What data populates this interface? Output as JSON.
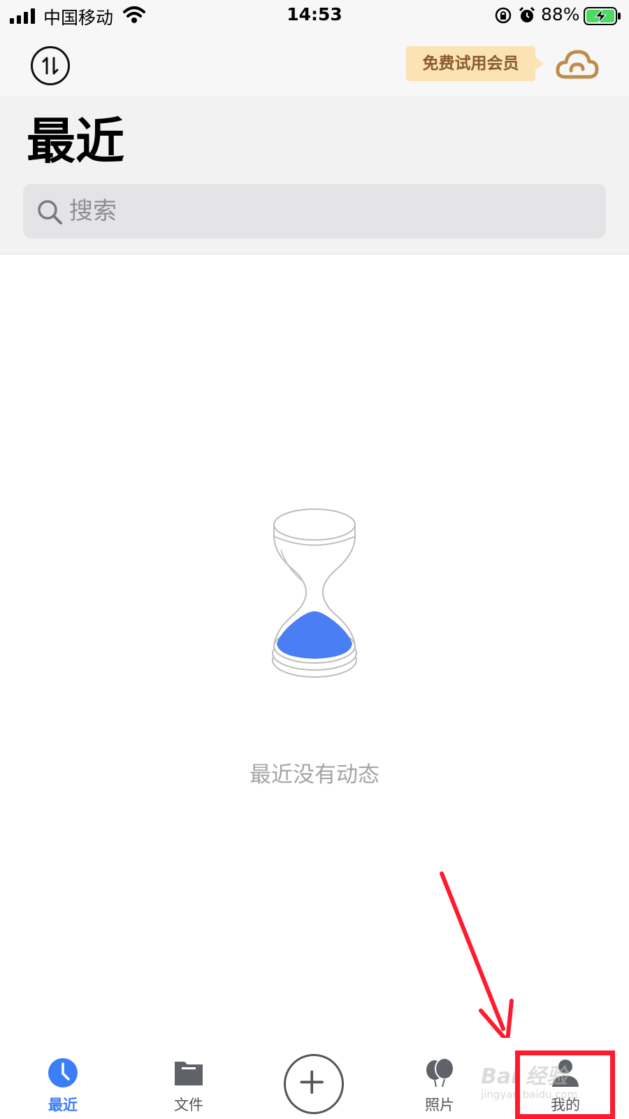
{
  "status_bar": {
    "carrier": "中国移动",
    "time": "14:53",
    "battery_percent": "88%"
  },
  "nav": {
    "member_badge": "免费试用会员"
  },
  "header": {
    "title": "最近",
    "search_placeholder": "搜索"
  },
  "empty_state": {
    "message": "最近没有动态"
  },
  "tabs": [
    {
      "label": "最近",
      "icon": "clock-icon",
      "active": true
    },
    {
      "label": "文件",
      "icon": "folder-icon",
      "active": false
    },
    {
      "label": "照片",
      "icon": "balloons-icon",
      "active": false
    },
    {
      "label": "我的",
      "icon": "person-icon",
      "active": false
    }
  ],
  "add_button": {
    "icon": "plus-icon"
  },
  "watermark": {
    "main": "Bai 经验",
    "sub": "jingyan.baidu.com"
  },
  "colors": {
    "accent": "#3b7ef7",
    "badge_bg": "#fbe3b4",
    "badge_text": "#8a5a2b",
    "highlight_red": "#ff1a2e"
  }
}
